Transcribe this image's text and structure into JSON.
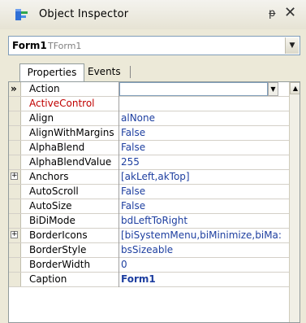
{
  "window": {
    "title": "Object Inspector",
    "pin_glyph": "ᵽ",
    "close_glyph": "✕"
  },
  "selector": {
    "name": "Form1",
    "type": "TForm1",
    "dropdown_glyph": "▼"
  },
  "tabs": [
    {
      "label": "Properties",
      "active": true
    },
    {
      "label": "Events",
      "active": false
    }
  ],
  "properties": [
    {
      "name": "Action",
      "value": "",
      "marker": "»",
      "special": "dropdown"
    },
    {
      "name": "ActiveControl",
      "value": "",
      "color": "red"
    },
    {
      "name": "Align",
      "value": "alNone"
    },
    {
      "name": "AlignWithMargins",
      "value": "False"
    },
    {
      "name": "AlphaBlend",
      "value": "False"
    },
    {
      "name": "AlphaBlendValue",
      "value": "255"
    },
    {
      "name": "Anchors",
      "value": "[akLeft,akTop]",
      "expandable": true
    },
    {
      "name": "AutoScroll",
      "value": "False"
    },
    {
      "name": "AutoSize",
      "value": "False"
    },
    {
      "name": "BiDiMode",
      "value": "bdLeftToRight"
    },
    {
      "name": "BorderIcons",
      "value": "[biSystemMenu,biMinimize,biMa:",
      "expandable": true
    },
    {
      "name": "BorderStyle",
      "value": "bsSizeable"
    },
    {
      "name": "BorderWidth",
      "value": "0"
    },
    {
      "name": "Caption",
      "value": "Form1",
      "bold": true
    }
  ],
  "icons": {
    "expand": "⊞",
    "scroll_up": "▲"
  }
}
